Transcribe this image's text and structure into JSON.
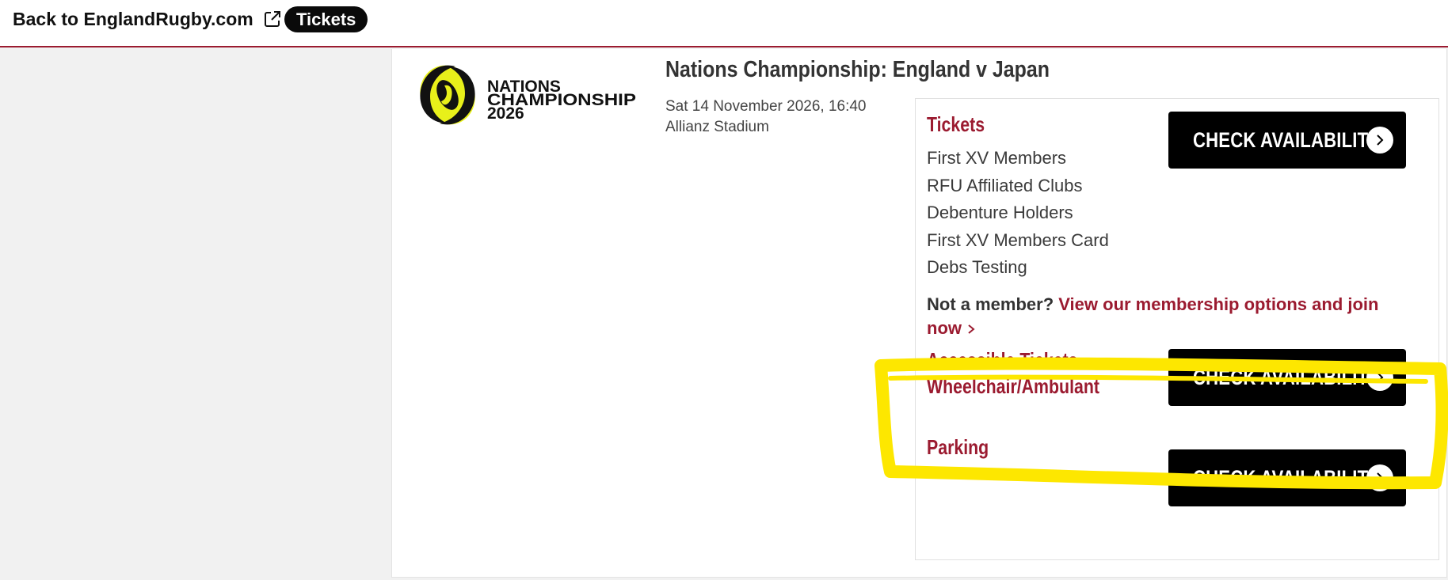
{
  "topbar": {
    "back_link_label": "Back to EnglandRugby.com",
    "back_link_icon": "external-link-icon",
    "tickets_pill_label": "Tickets"
  },
  "event": {
    "logo": {
      "line1": "NATIONS",
      "line2": "CHAMPIONSHIP",
      "line3": "2026",
      "accent_color": "#e8f01a"
    },
    "title": "Nations Championship: England v Japan",
    "date": "Sat 14 November 2026, 16:40",
    "venue": "Allianz Stadium"
  },
  "sections": {
    "tickets": {
      "heading": "Tickets",
      "items": [
        "First XV Members",
        "RFU Affiliated Clubs",
        "Debenture Holders",
        "First XV Members Card",
        "Debs Testing"
      ],
      "button_label": "CHECK AVAILABILITY",
      "not_member_text": "Not a member?",
      "membership_link": "View our membership options and join now"
    },
    "accessible": {
      "heading_line1": "Accessible Tickets -",
      "heading_line2": "Wheelchair/Ambulant",
      "button_label": "CHECK AVAILABILITY"
    },
    "parking": {
      "heading": "Parking",
      "button_label": "CHECK AVAILABILITY"
    }
  },
  "colors": {
    "brand_red": "#9b1b30",
    "button_black": "#000000",
    "highlight_yellow": "#fde700",
    "page_background": "#f1f1f1"
  }
}
